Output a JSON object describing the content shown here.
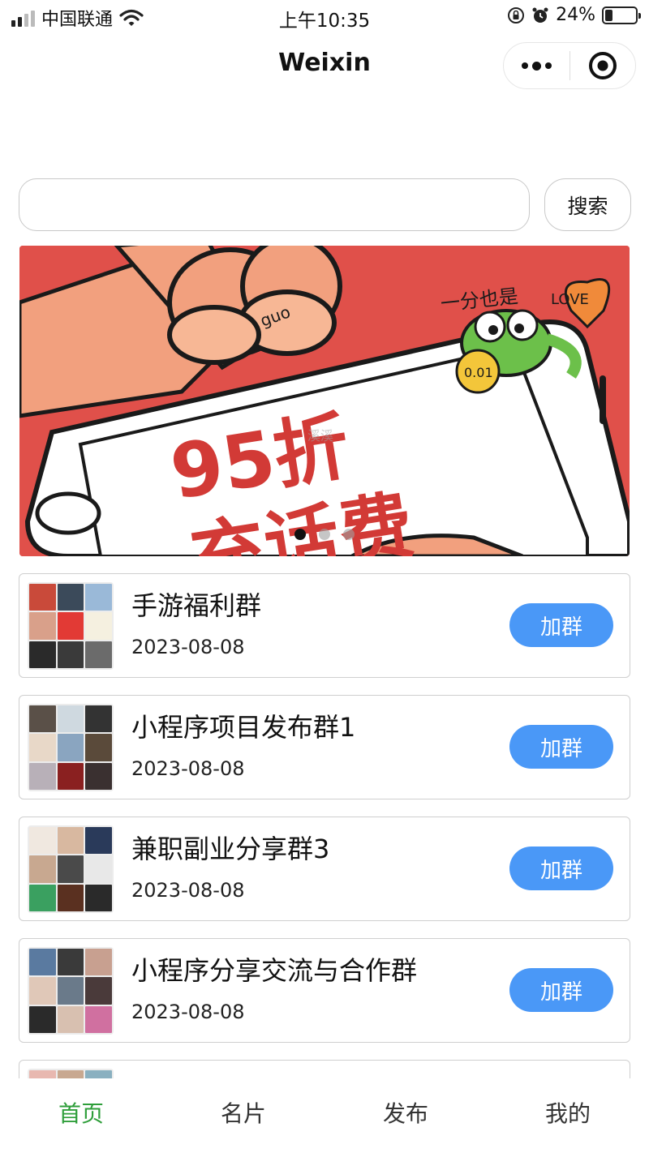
{
  "status_bar": {
    "carrier": "中国联通",
    "time": "上午10:35",
    "battery": "24%",
    "battery_level": 0.24,
    "icons": [
      "signal-icon",
      "wifi-icon",
      "rotation-lock-icon",
      "alarm-icon",
      "battery-icon"
    ]
  },
  "nav": {
    "title": "Weixin",
    "icons": [
      "more-icon",
      "close-miniprogram-icon"
    ]
  },
  "search": {
    "placeholder": "",
    "value": "",
    "button_label": "搜索"
  },
  "banner": {
    "text_line1": "95折",
    "text_line2": "充话费",
    "tag_text": "一分也是",
    "love_text": "LOVE",
    "coin_text": "0.01",
    "ring_text": "guo",
    "watermark": "溪溪",
    "slide_count": 3,
    "active_slide": 1,
    "colors": {
      "background": "#e0504a",
      "text": "#d23a36",
      "skin": "#f2a07e",
      "frog": "#6cc04a"
    }
  },
  "groups": [
    {
      "title": "手游福利群",
      "date": "2023-08-08",
      "button": "加群"
    },
    {
      "title": "小程序项目发布群1",
      "date": "2023-08-08",
      "button": "加群"
    },
    {
      "title": "兼职副业分享群3",
      "date": "2023-08-08",
      "button": "加群"
    },
    {
      "title": "小程序分享交流与合作群",
      "date": "2023-08-08",
      "button": "加群"
    },
    {
      "title": "",
      "date": "",
      "button": ""
    }
  ],
  "tabbar": {
    "items": [
      {
        "label": "首页",
        "active": true
      },
      {
        "label": "名片",
        "active": false
      },
      {
        "label": "发布",
        "active": false
      },
      {
        "label": "我的",
        "active": false
      }
    ],
    "active_color": "#2e9e3a"
  },
  "colors": {
    "accent": "#4a98f7"
  }
}
